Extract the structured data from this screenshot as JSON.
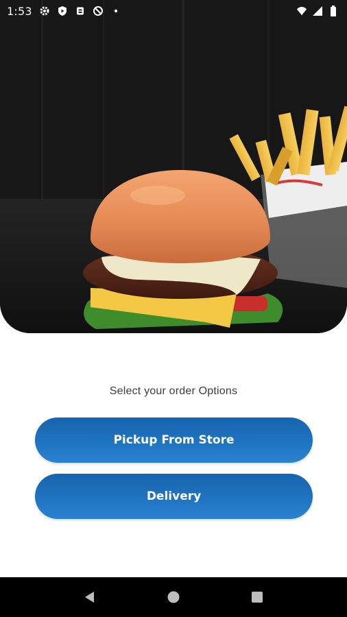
{
  "status_bar": {
    "time": "1:53",
    "icons_left": [
      "settings-icon",
      "play-protect-icon",
      "bug-report-icon",
      "no-sim-icon",
      "notification-dot-icon"
    ],
    "icons_right": [
      "wifi-icon",
      "signal-icon",
      "battery-icon"
    ]
  },
  "hero": {
    "image": "burger-and-fries-photo"
  },
  "main": {
    "prompt": "Select your order Options",
    "options": [
      {
        "label": "Pickup From Store"
      },
      {
        "label": "Delivery"
      }
    ]
  },
  "nav_bar": {
    "buttons": [
      "back-icon",
      "home-icon",
      "recents-icon"
    ]
  },
  "colors": {
    "button_top": "#1864ae",
    "button_bottom": "#2a83d1",
    "prompt_text": "#3d3d3d",
    "nav_background": "#000000"
  }
}
